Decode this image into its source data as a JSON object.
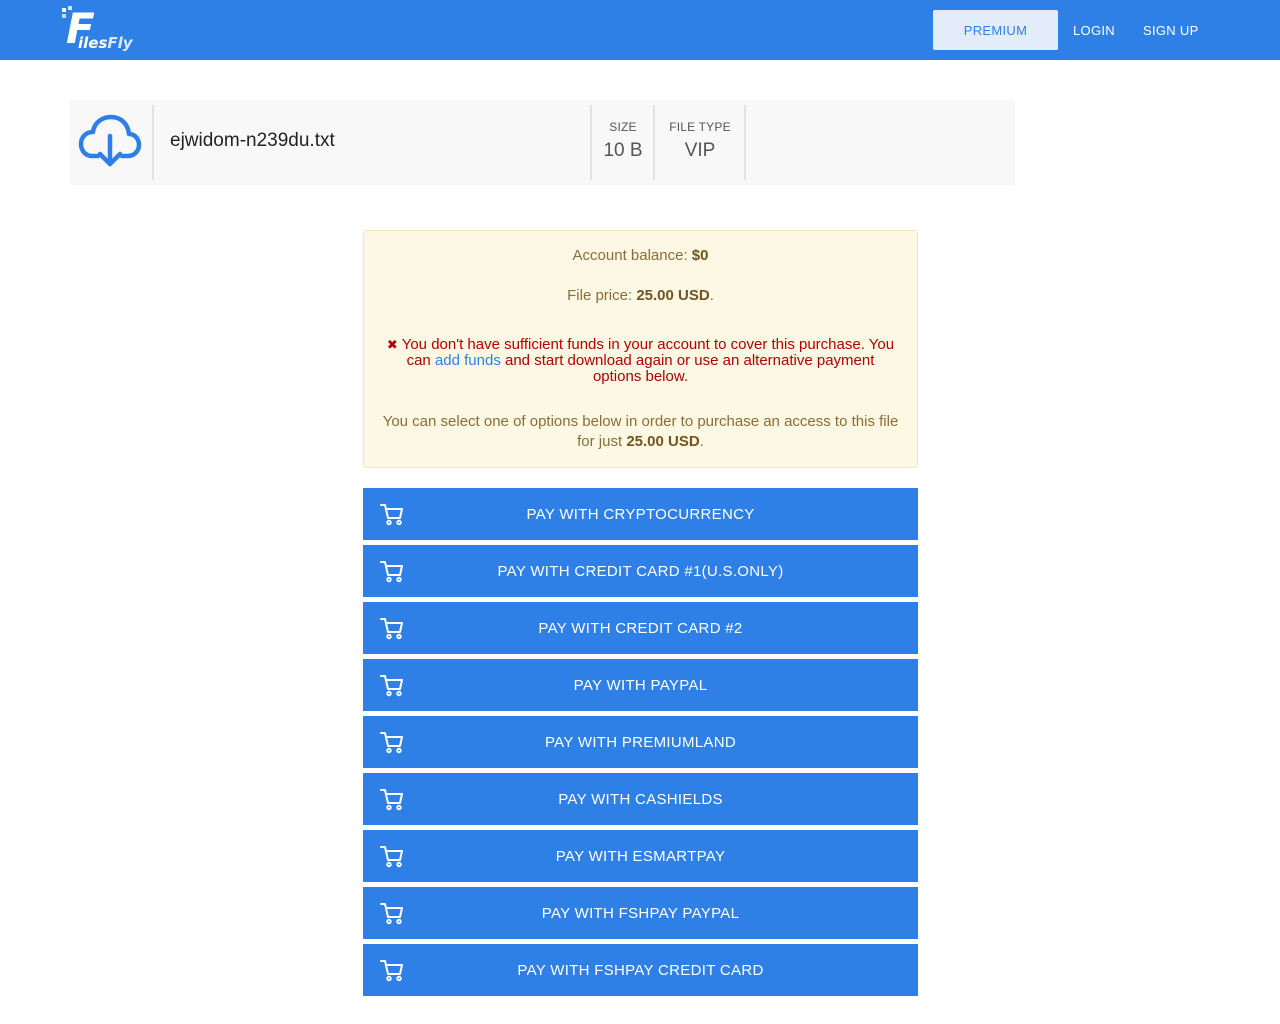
{
  "header": {
    "logo_initial": "F",
    "logo_text": "iles",
    "logo_text_accent": "Fly",
    "nav": {
      "premium": "PREMIUM",
      "login": "LOGIN",
      "signup": "SIGN UP"
    },
    "colors": {
      "primary": "#2f80e6",
      "premium_bg": "#e3ecf9"
    }
  },
  "file": {
    "icon": "cloud-download-icon",
    "name": "ejwidom-n239du.txt",
    "size_label": "SIZE",
    "size_value": "10 B",
    "type_label": "FILE TYPE",
    "type_value": "VIP"
  },
  "notice": {
    "balance_label": "Account balance: ",
    "balance_value": "$0",
    "price_label": "File price: ",
    "price_value": "25.00 USD",
    "price_suffix": ".",
    "error_icon": "✖",
    "error_text_1": " You don't have sufficient funds in your account to cover this purchase. You can ",
    "error_link": "add funds",
    "error_text_2": " and start download again or use an alternative payment options below.",
    "info_text": "You can select one of options below in order to purchase an access to this file for just ",
    "info_price": "25.00 USD",
    "info_suffix": "."
  },
  "payment_buttons": [
    {
      "label": "PAY WITH CRYPTOCURRENCY",
      "icon": "cart-icon"
    },
    {
      "label": "PAY WITH CREDIT CARD #1(U.S.ONLY)",
      "icon": "cart-icon"
    },
    {
      "label": "PAY WITH CREDIT CARD #2",
      "icon": "cart-icon"
    },
    {
      "label": "PAY WITH PAYPAL",
      "icon": "cart-icon"
    },
    {
      "label": "PAY WITH PREMIUMLAND",
      "icon": "cart-icon"
    },
    {
      "label": "PAY WITH CASHIELDS",
      "icon": "cart-icon"
    },
    {
      "label": "PAY WITH ESMARTPAY",
      "icon": "cart-icon"
    },
    {
      "label": "PAY WITH FSHPAY PAYPAL",
      "icon": "cart-icon"
    },
    {
      "label": "PAY WITH FSHPAY CREDIT CARD",
      "icon": "cart-icon"
    }
  ]
}
